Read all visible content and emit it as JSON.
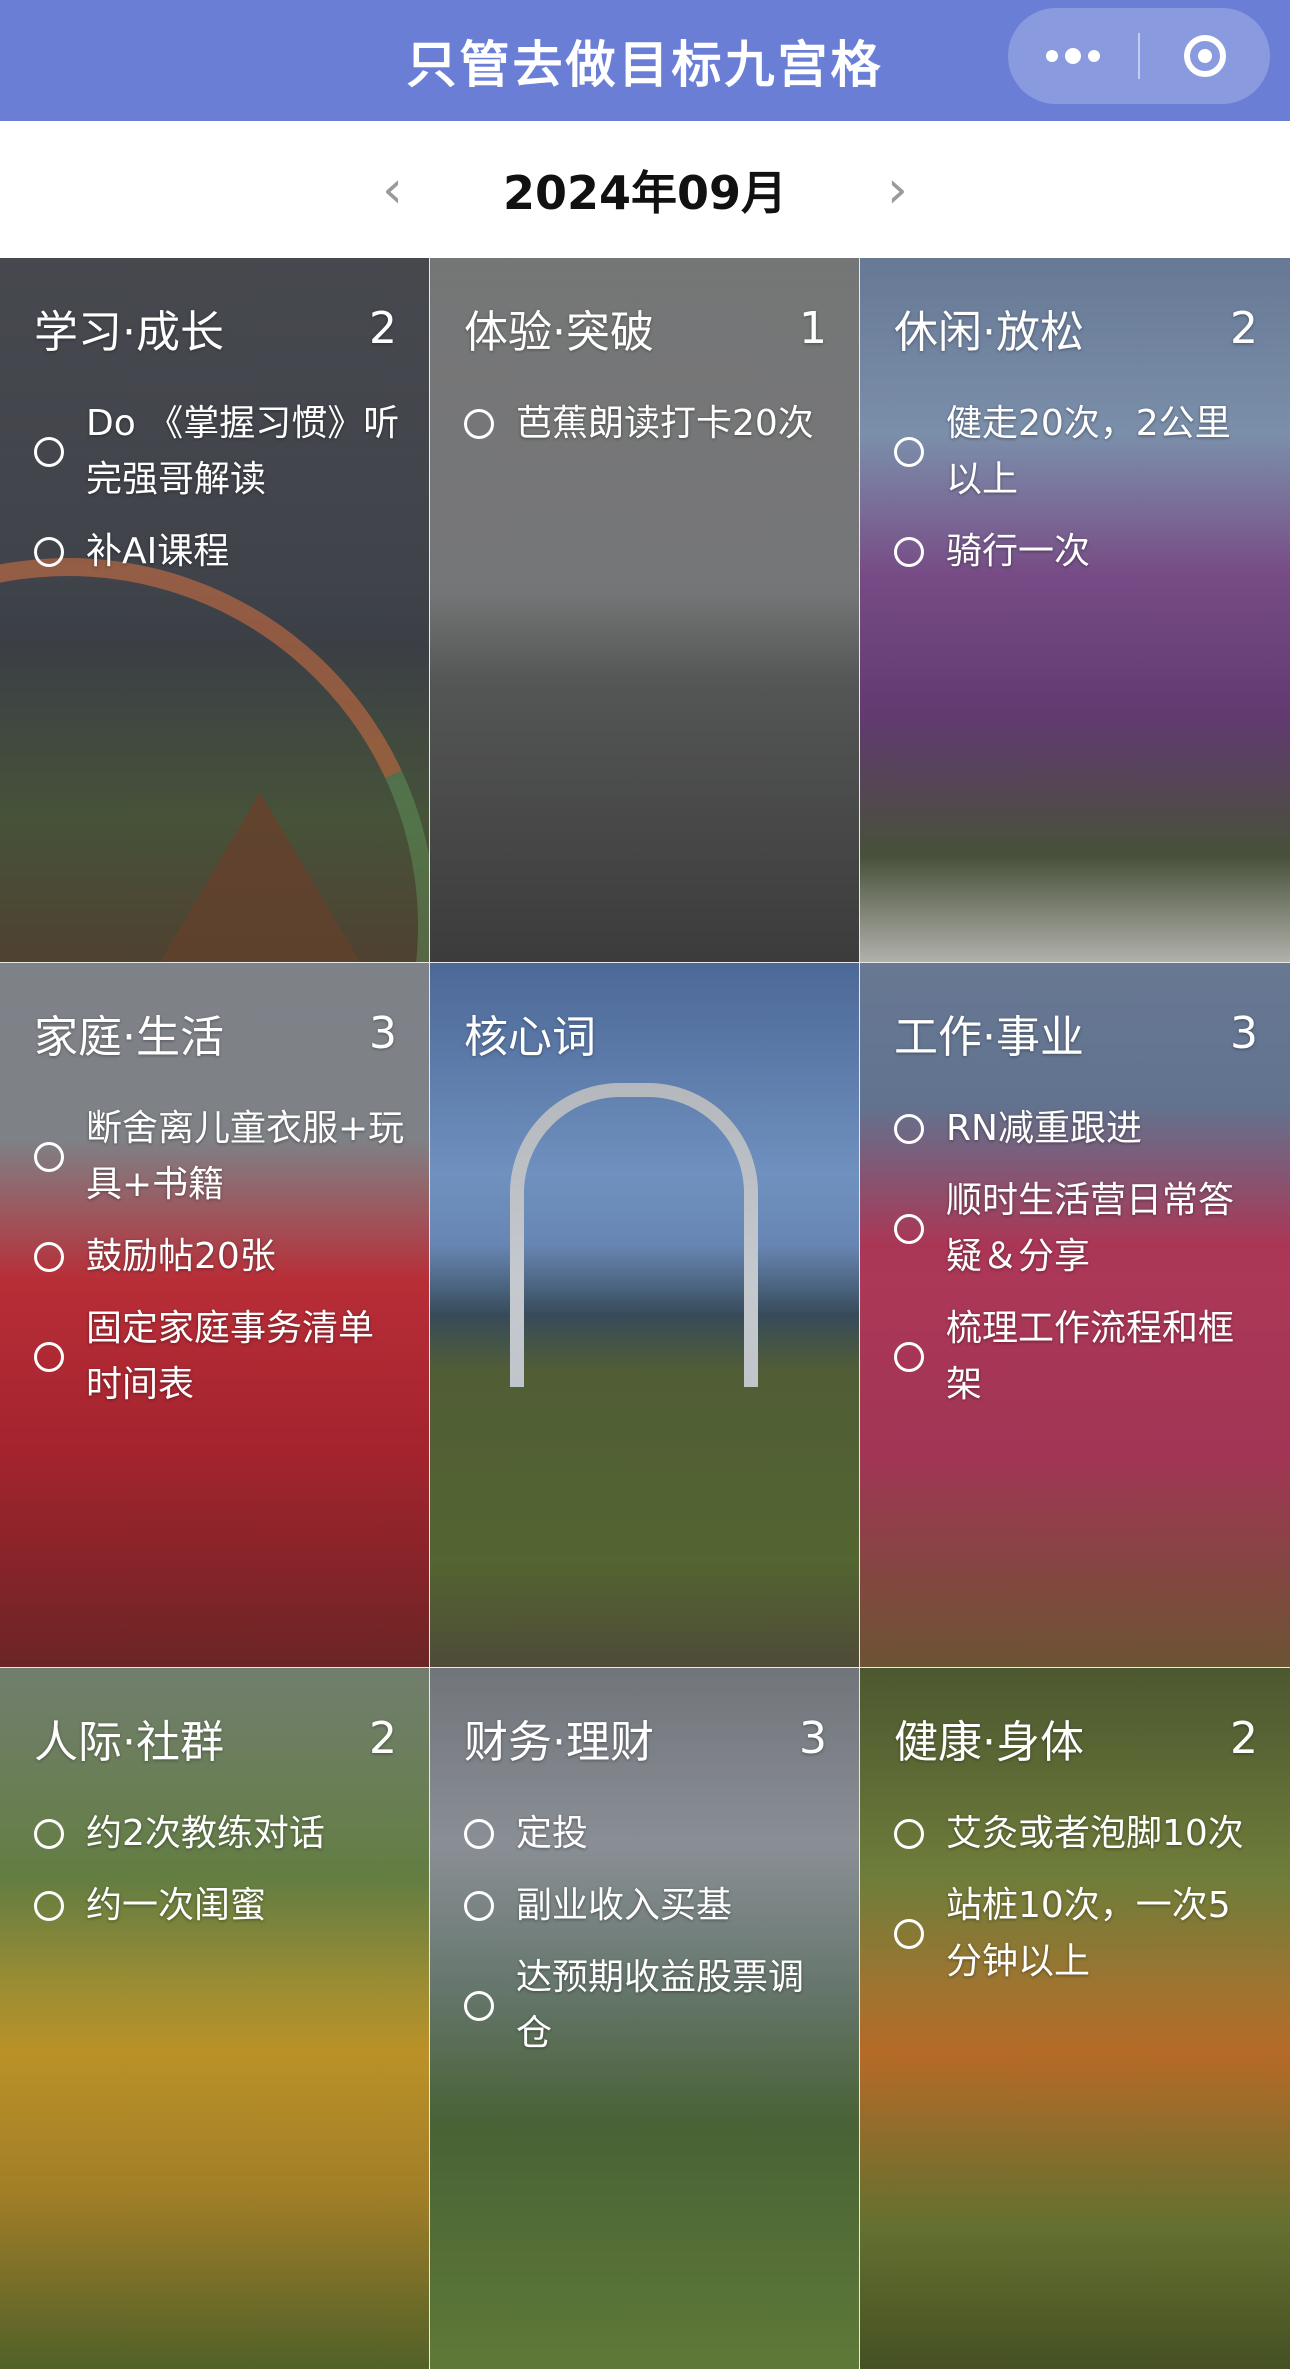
{
  "header": {
    "title": "只管去做目标九宫格",
    "more_icon": "more-dots-icon",
    "close_icon": "target-circle-icon"
  },
  "month_nav": {
    "label": "2024年09月",
    "prev": "‹",
    "next": "›"
  },
  "grid": [
    {
      "title": "学习·成长",
      "count": "2",
      "items": [
        "Do 《掌握习惯》听完强哥解读",
        "补AI课程"
      ]
    },
    {
      "title": "体验·突破",
      "count": "1",
      "items": [
        "芭蕉朗读打卡20次"
      ]
    },
    {
      "title": "休闲·放松",
      "count": "2",
      "items": [
        "健走20次，2公里以上",
        "骑行一次"
      ]
    },
    {
      "title": "家庭·生活",
      "count": "3",
      "items": [
        "断舍离儿童衣服+玩具+书籍",
        "鼓励帖20张",
        "固定家庭事务清单时间表"
      ]
    },
    {
      "title": "核心词",
      "count": "",
      "items": []
    },
    {
      "title": "工作·事业",
      "count": "3",
      "items": [
        "RN减重跟进",
        "顺时生活营日常答疑＆分享",
        "梳理工作流程和框架"
      ]
    },
    {
      "title": "人际·社群",
      "count": "2",
      "items": [
        "约2次教练对话",
        "约一次闺蜜"
      ]
    },
    {
      "title": "财务·理财",
      "count": "3",
      "items": [
        "定投",
        "副业收入买基",
        "达预期收益股票调仓"
      ]
    },
    {
      "title": "健康·身体",
      "count": "2",
      "items": [
        "艾灸或者泡脚10次",
        "站桩10次，一次5分钟以上"
      ]
    }
  ]
}
